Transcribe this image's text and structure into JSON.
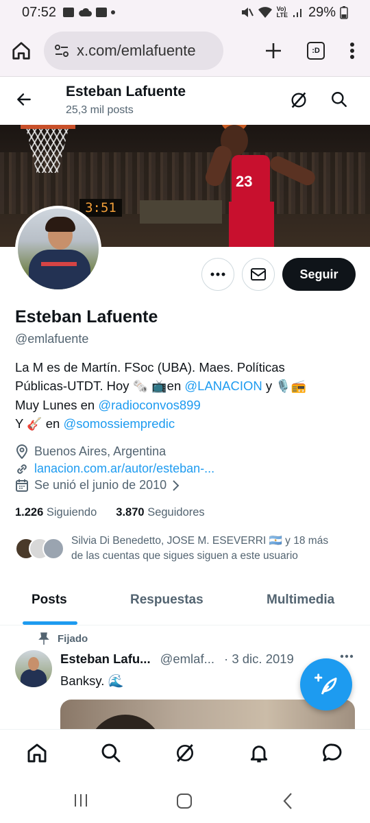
{
  "status_bar": {
    "time": "07:52",
    "battery": "29%"
  },
  "browser": {
    "url": "x.com/emlafuente",
    "tab_label": ":D"
  },
  "header": {
    "name": "Esteban Lafuente",
    "post_count": "25,3 mil posts"
  },
  "banner": {
    "clock": "3:51",
    "jersey_number": "23"
  },
  "actions": {
    "follow_label": "Seguir"
  },
  "profile": {
    "name": "Esteban Lafuente",
    "handle": "@emlafuente",
    "bio_line1": "La M es de Martín. FSoc (UBA). Maes. Políticas",
    "bio_line2_a": "Públicas-UTDT. Hoy ",
    "bio_line2_emoji1": "🗞️",
    "bio_line2_emoji2": "📺",
    "bio_line2_b": "en ",
    "bio_link1": "@LANACION",
    "bio_line2_c": " y ",
    "bio_line2_emoji3": "🎙️",
    "bio_line2_emoji4": "📻",
    "bio_line3_a": "Muy Lunes en ",
    "bio_link2": "@radioconvos899",
    "bio_line4_a": "Y ",
    "bio_line4_emoji": "🎸",
    "bio_line4_b": " en ",
    "bio_link3": "@somossiempredic",
    "location": "Buenos Aires, Argentina",
    "website": "lanacion.com.ar/autor/esteban-...",
    "joined": "Se unió el junio de 2010"
  },
  "stats": {
    "following_count": "1.226",
    "following_label": "Siguiendo",
    "followers_count": "3.870",
    "followers_label": "Seguidores"
  },
  "followed_by": {
    "line1": "Silvia Di Benedetto, JOSE M. ESEVERRI 🇦🇷 y 18 más",
    "line2": "de las cuentas que sigues siguen a este usuario"
  },
  "tabs": {
    "posts": "Posts",
    "replies": "Respuestas",
    "media": "Multimedia"
  },
  "post": {
    "pinned_label": "Fijado",
    "author_name": "Esteban Lafu...",
    "author_handle": "@emlaf...",
    "date": "· 3 dic. 2019",
    "text": "Banksy. 🌊"
  },
  "colors": {
    "accent": "#1d9bf0",
    "text_primary": "#0f1419",
    "text_secondary": "#536471",
    "follow_button_bg": "#0f1419"
  },
  "icons": {
    "back": "arrow-left-icon",
    "grok": "grok-icon",
    "search": "search-icon",
    "more": "more-dots-icon",
    "message": "envelope-icon",
    "location": "location-pin-icon",
    "link": "link-icon",
    "calendar": "calendar-icon",
    "pin": "pin-icon",
    "compose": "compose-post-icon",
    "home": "home-icon",
    "notifications": "bell-icon",
    "messages": "chat-bubble-icon"
  }
}
